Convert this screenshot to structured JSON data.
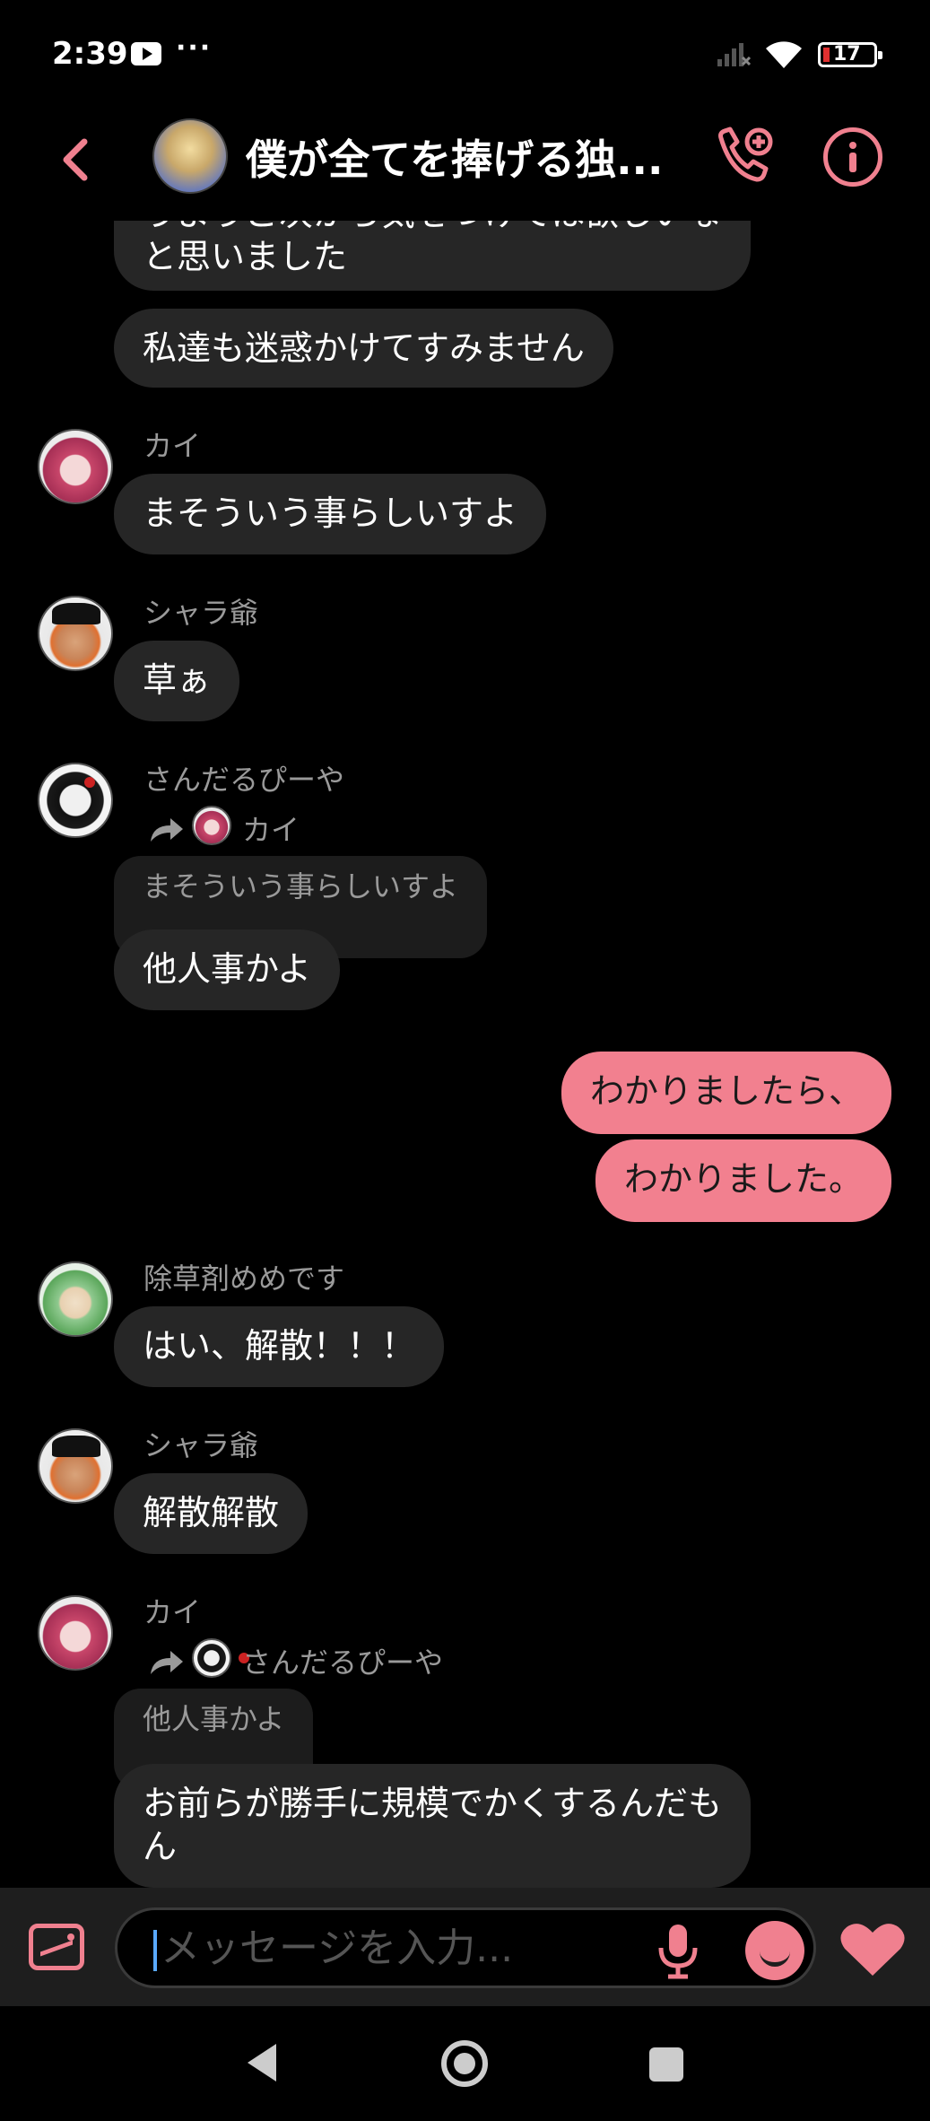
{
  "status_bar": {
    "time": "2:39",
    "more": "···",
    "battery": "17"
  },
  "header": {
    "title": "僕が全てを捧げる独..."
  },
  "messages": {
    "m0": "うようご次から気をつけては欲しいなと思いました",
    "m1": "私達も迷惑かけてすみません",
    "kai1": {
      "sender": "カイ",
      "text": "まそういう事らしいすよ"
    },
    "shara1": {
      "sender": "シャラ爺",
      "text": "草ぁ"
    },
    "sandal1": {
      "sender": "さんだるぴーや",
      "reply_to": "カイ",
      "quote": "まそういう事らしいすよ",
      "text": "他人事かよ"
    },
    "out1": "わかりましたら、",
    "out2": "わかりました。",
    "jyosou1": {
      "sender": "除草剤めめです",
      "text": "はい、解散！！！"
    },
    "shara2": {
      "sender": "シャラ爺",
      "text": "解散解散"
    },
    "kai2": {
      "sender": "カイ",
      "reply_to": "さんだるぴーや",
      "quote": "他人事かよ",
      "text": "お前らが勝手に規模でかくするんだもん"
    }
  },
  "composer": {
    "placeholder": "メッセージを入力..."
  }
}
